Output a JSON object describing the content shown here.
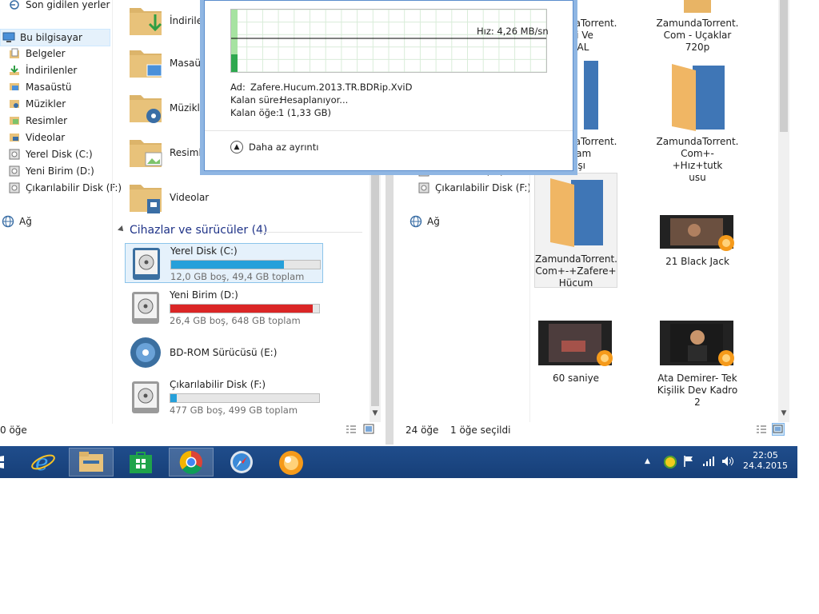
{
  "left_nav": {
    "items": [
      {
        "label": "Son gidilen yerler",
        "icon": "recent-places-icon"
      },
      {
        "label": "Bu bilgisayar",
        "icon": "this-pc-icon",
        "selected": true
      },
      {
        "label": "Belgeler",
        "icon": "documents-icon"
      },
      {
        "label": "İndirilenler",
        "icon": "downloads-icon"
      },
      {
        "label": "Masaüstü",
        "icon": "desktop-icon"
      },
      {
        "label": "Müzikler",
        "icon": "music-icon"
      },
      {
        "label": "Resimler",
        "icon": "pictures-icon"
      },
      {
        "label": "Videolar",
        "icon": "videos-icon"
      },
      {
        "label": "Yerel Disk (C:)",
        "icon": "drive-icon"
      },
      {
        "label": "Yeni Birim (D:)",
        "icon": "drive-icon"
      },
      {
        "label": "Çıkarılabilir Disk (F:)",
        "icon": "drive-icon"
      }
    ],
    "network": "Ağ"
  },
  "folders": [
    {
      "label": "İndirilen"
    },
    {
      "label": "Masaüst"
    },
    {
      "label": "Müzikle"
    },
    {
      "label": "Resimle"
    },
    {
      "label": "Videolar"
    }
  ],
  "devices": {
    "heading": "Cihazlar ve sürücüler (4)",
    "drives": [
      {
        "name": "Yerel Disk (C:)",
        "info": "12,0 GB boş, 49,4 GB toplam",
        "used": 0.757,
        "color": "#26a0da",
        "selected": true
      },
      {
        "name": "Yeni Birim (D:)",
        "info": "26,4 GB boş, 648 GB toplam",
        "used": 0.959,
        "color": "#da2626"
      },
      {
        "name": "BD-ROM Sürücüsü (E:)",
        "info": "",
        "used": null
      },
      {
        "name": "Çıkarılabilir Disk (F:)",
        "info": "477 GB boş, 499 GB toplam",
        "used": 0.044,
        "color": "#26a0da"
      }
    ]
  },
  "left_status": {
    "count": "0 öğe"
  },
  "dialog": {
    "speed": "Hız: 4,26 MB/sn",
    "name_label": "Ad:",
    "name_value": "Zafere.Hucum.2013.TR.BDRip.XviD",
    "time_label": "Kalan süre:",
    "time_value": "Hesaplanıyor...",
    "items_label": "Kalan öğe:",
    "items_value": "1 (1,33 GB)",
    "less_details": "Daha az ayrıntı"
  },
  "right_nav": {
    "items": [
      {
        "label": "Yeni Birim (D:)"
      },
      {
        "label": "Çıkarılabilir Disk (F:)"
      }
    ],
    "network": "Ağ"
  },
  "files": [
    {
      "lines": [
        "ZamundaTorrent.",
        "Hizli Ve",
        "DUAL"
      ],
      "type": "folder-partial"
    },
    {
      "lines": [
        "ZamundaTorrent.",
        "Com - Uçaklar",
        "720p"
      ],
      "type": "folder-partial"
    },
    {
      "lines": [
        "ZamundaTorrent.",
        "Yaşam",
        "vaşı"
      ],
      "type": "folder-partial"
    },
    {
      "lines": [
        "ZamundaTorrent.",
        "Com+-+Hız+tutk",
        "usu"
      ],
      "type": "folder"
    },
    {
      "lines": [
        "ZamundaTorrent.",
        "Com+-+Zafere+",
        "Hücum"
      ],
      "type": "folder",
      "selected": true
    },
    {
      "lines": [
        "21 Black Jack"
      ],
      "type": "video"
    },
    {
      "lines": [
        "60 saniye"
      ],
      "type": "video"
    },
    {
      "lines": [
        "Ata Demirer- Tek",
        "Kişilik Dev Kadro",
        "2"
      ],
      "type": "video"
    }
  ],
  "right_status": {
    "count": "24 öğe",
    "selected": "1 öğe seçildi"
  },
  "taskbar": {
    "apps": [
      "start-icon",
      "internet-explorer-icon",
      "file-explorer-icon",
      "store-icon",
      "chrome-icon",
      "safari-icon",
      "media-player-icon"
    ],
    "time": "22:05",
    "date": "24.4.2015"
  }
}
